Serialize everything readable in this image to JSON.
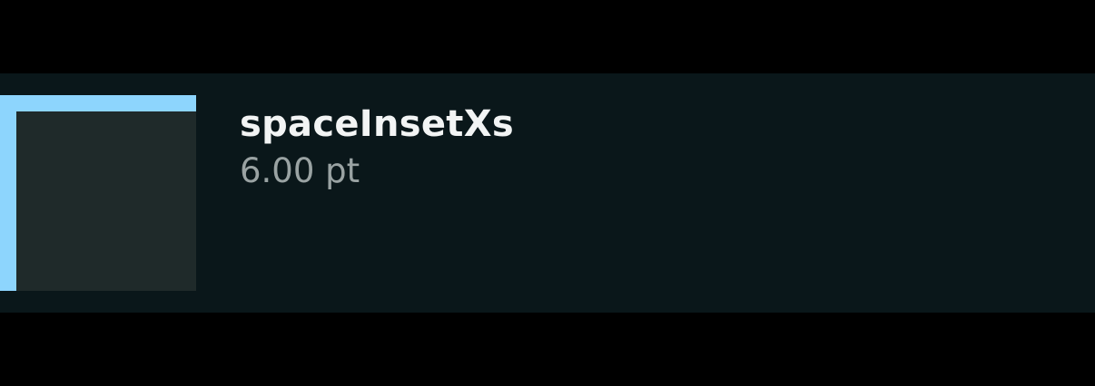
{
  "token": {
    "name": "spaceInsetXs",
    "value": "6.00 pt"
  },
  "colors": {
    "page_background": "#000000",
    "row_background": "#0a171a",
    "inset_highlight": "#8dd5fd",
    "swatch_fill": "#1f2a2a",
    "name_text": "#f2f4f4",
    "value_text": "#9aa3a3"
  }
}
